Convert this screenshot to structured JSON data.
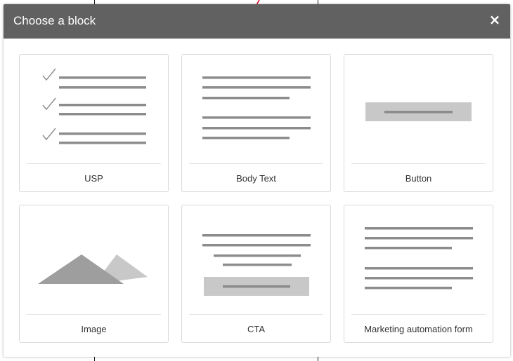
{
  "dialog": {
    "title": "Choose a block",
    "close_label": "×"
  },
  "blocks": [
    {
      "label": "USP",
      "icon": "usp-checklist-icon"
    },
    {
      "label": "Body Text",
      "icon": "body-text-icon"
    },
    {
      "label": "Button",
      "icon": "button-block-icon"
    },
    {
      "label": "Image",
      "icon": "image-mountains-icon"
    },
    {
      "label": "CTA",
      "icon": "cta-block-icon"
    },
    {
      "label": "Marketing automation form",
      "icon": "form-block-icon"
    }
  ],
  "colors": {
    "header_bg": "#616161",
    "header_text": "#ffffff",
    "illustration_line": "#8c8c8c",
    "illustration_fill": "#c8c8c8",
    "card_border": "#d9d9d9",
    "background_accent": "#d0021b"
  }
}
